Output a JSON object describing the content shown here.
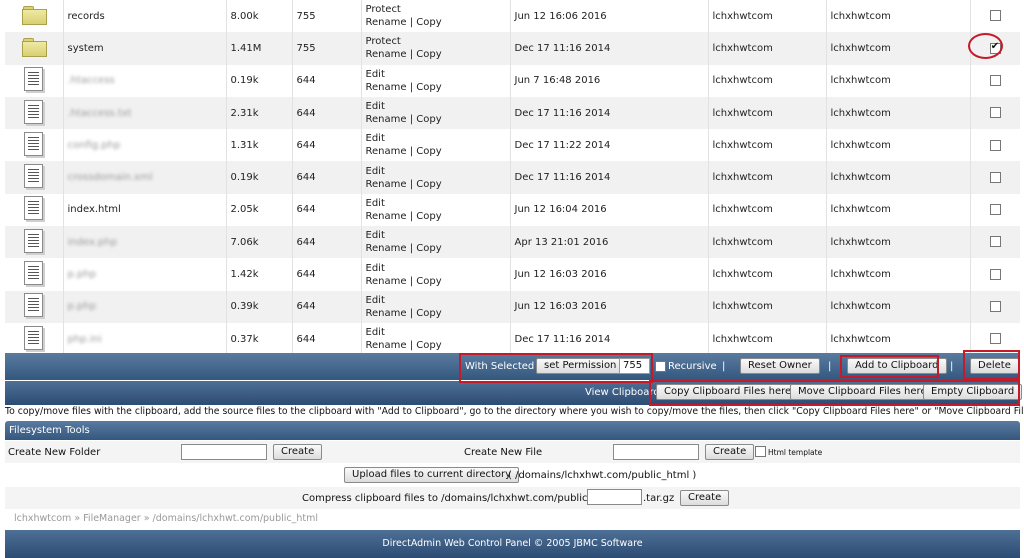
{
  "files": [
    {
      "type": "folder",
      "name": "records",
      "blurred": false,
      "size": "8.00k",
      "perm": "755",
      "action1": "Protect",
      "action2": "Rename",
      "action3": "Copy",
      "date": "Jun 12 16:06 2016",
      "owner": "lchxhwtcom",
      "group": "lchxhwtcom",
      "checked": false
    },
    {
      "type": "folder",
      "name": "system",
      "blurred": false,
      "size": "1.41M",
      "perm": "755",
      "action1": "Protect",
      "action2": "Rename",
      "action3": "Copy",
      "date": "Dec 17 11:16 2014",
      "owner": "lchxhwtcom",
      "group": "lchxhwtcom",
      "checked": true
    },
    {
      "type": "file",
      "name": ".htaccess",
      "blurred": true,
      "size": "0.19k",
      "perm": "644",
      "action1": "Edit",
      "action2": "Rename",
      "action3": "Copy",
      "date": "Jun 7 16:48 2016",
      "owner": "lchxhwtcom",
      "group": "lchxhwtcom",
      "checked": false
    },
    {
      "type": "file",
      "name": ".htaccess.txt",
      "blurred": true,
      "size": "2.31k",
      "perm": "644",
      "action1": "Edit",
      "action2": "Rename",
      "action3": "Copy",
      "date": "Dec 17 11:16 2014",
      "owner": "lchxhwtcom",
      "group": "lchxhwtcom",
      "checked": false
    },
    {
      "type": "file",
      "name": "config.php",
      "blurred": true,
      "size": "1.31k",
      "perm": "644",
      "action1": "Edit",
      "action2": "Rename",
      "action3": "Copy",
      "date": "Dec 17 11:22 2014",
      "owner": "lchxhwtcom",
      "group": "lchxhwtcom",
      "checked": false
    },
    {
      "type": "file",
      "name": "crossdomain.xml",
      "blurred": true,
      "size": "0.19k",
      "perm": "644",
      "action1": "Edit",
      "action2": "Rename",
      "action3": "Copy",
      "date": "Dec 17 11:16 2014",
      "owner": "lchxhwtcom",
      "group": "lchxhwtcom",
      "checked": false
    },
    {
      "type": "file",
      "name": "index.html",
      "blurred": false,
      "size": "2.05k",
      "perm": "644",
      "action1": "Edit",
      "action2": "Rename",
      "action3": "Copy",
      "date": "Jun 12 16:04 2016",
      "owner": "lchxhwtcom",
      "group": "lchxhwtcom",
      "checked": false
    },
    {
      "type": "file",
      "name": "index.php",
      "blurred": true,
      "size": "7.06k",
      "perm": "644",
      "action1": "Edit",
      "action2": "Rename",
      "action3": "Copy",
      "date": "Apr 13 21:01 2016",
      "owner": "lchxhwtcom",
      "group": "lchxhwtcom",
      "checked": false
    },
    {
      "type": "file",
      "name": "p.php",
      "blurred": true,
      "size": "1.42k",
      "perm": "644",
      "action1": "Edit",
      "action2": "Rename",
      "action3": "Copy",
      "date": "Jun 12 16:03 2016",
      "owner": "lchxhwtcom",
      "group": "lchxhwtcom",
      "checked": false
    },
    {
      "type": "file",
      "name": "p.php",
      "blurred": true,
      "size": "0.39k",
      "perm": "644",
      "action1": "Edit",
      "action2": "Rename",
      "action3": "Copy",
      "date": "Jun 12 16:03 2016",
      "owner": "lchxhwtcom",
      "group": "lchxhwtcom",
      "checked": false
    },
    {
      "type": "file",
      "name": "php.ini",
      "blurred": true,
      "size": "0.37k",
      "perm": "644",
      "action1": "Edit",
      "action2": "Rename",
      "action3": "Copy",
      "date": "Dec 17 11:16 2014",
      "owner": "lchxhwtcom",
      "group": "lchxhwtcom",
      "checked": false
    }
  ],
  "actions_bar": {
    "with_selected_label": "With Selected",
    "set_permission_label": "set Permission",
    "permission_value": "755",
    "recursive_label": "Recursive",
    "separator": "|",
    "reset_owner_label": "Reset Owner",
    "add_to_clipboard_label": "Add to Clipboard",
    "delete_label": "Delete"
  },
  "clipboard_bar": {
    "view_clipboard_label": "View Clipboard",
    "copy_here_label": "Copy Clipboard Files here",
    "move_here_label": "Move Clipboard Files here",
    "empty_label": "Empty Clipboard"
  },
  "clipboard_note": "To copy/move files with the clipboard, add the source files to the clipboard with \"Add to Clipboard\", go to the directory where you wish to copy/move the files, then click \"Copy Clipboard Files here\" or \"Move Clipboard Files here\"",
  "tools": {
    "header": "Filesystem Tools",
    "create_folder_label": "Create New Folder",
    "create_folder_button": "Create",
    "create_file_label": "Create New File",
    "create_file_button": "Create",
    "html_template_label": "Html template",
    "upload_button": "Upload files to current directory",
    "upload_path": "( /domains/lchxhwt.com/public_html )",
    "compress_label": "Compress clipboard files to /domains/lchxhwt.com/public_html/",
    "compress_ext": ".tar.gz",
    "compress_button": "Create"
  },
  "breadcrumb": "lchxhwtcom » FileManager » /domains/lchxhwt.com/public_html",
  "footer": "DirectAdmin Web Control Panel © 2005 JBMC Software",
  "colors": {
    "highlight": "#c41a2a",
    "bar": "#34577e"
  }
}
